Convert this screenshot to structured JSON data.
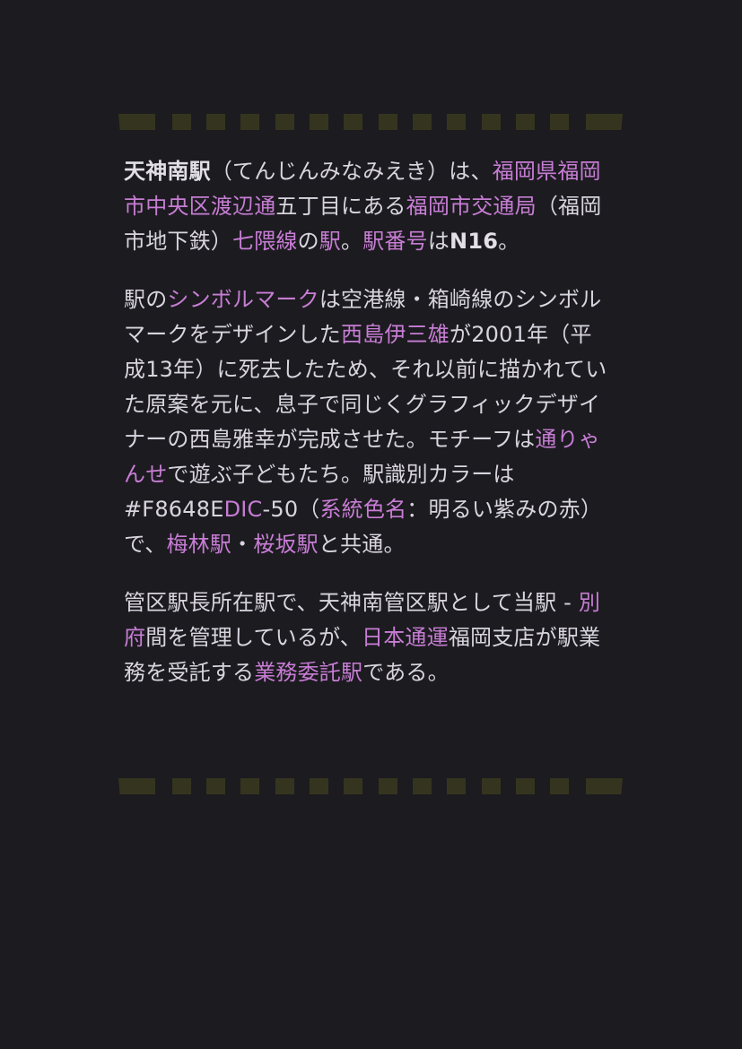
{
  "theme": {
    "background": "#1c1b20",
    "text": "#d8d5de",
    "link": "#c77dd4",
    "film_strip": "#35351f"
  },
  "paragraph1": {
    "s1": "天神南駅",
    "s2": "（てんじんみなみえき）は、",
    "s3": "福岡県",
    "s4": "福岡市",
    "s5": "中央区",
    "s6": "渡辺通",
    "s7": "五丁目にある",
    "s8": "福岡市交通局",
    "s9": "（福岡市地下鉄）",
    "s10": "七隈線",
    "s11": "の",
    "s12": "駅",
    "s13": "。",
    "s14": "駅番号",
    "s15": "は",
    "s16": "N16",
    "s17": "。"
  },
  "paragraph2": {
    "s1": "駅の",
    "s2": "シンボルマーク",
    "s3": "は空港線・箱崎線のシンボルマークをデザインした",
    "s4": "西島伊三雄",
    "s5": "が2001年（平成13年）に死去したため、それ以前に描かれていた原案を元に、息子で同じくグラフィックデザイナーの西島雅幸が完成させた。モチーフは",
    "s6": "通りゃんせ",
    "s7": "で遊ぶ子どもたち。駅識別カラーは#F8648E",
    "s8": "DIC",
    "s9": "-50（",
    "s10": "系統色名",
    "s11": "：明るい紫みの赤）で、",
    "s12": "梅林駅",
    "s13": "・",
    "s14": "桜坂駅",
    "s15": "と共通。"
  },
  "paragraph3": {
    "s1": "管区駅長所在駅で、天神南管区駅として当駅 - ",
    "s2": "別府",
    "s3": "間を管理しているが、",
    "s4": "日本通運",
    "s5": "福岡支店が駅業務を受託する",
    "s6": "業務委託駅",
    "s7": "である。"
  }
}
